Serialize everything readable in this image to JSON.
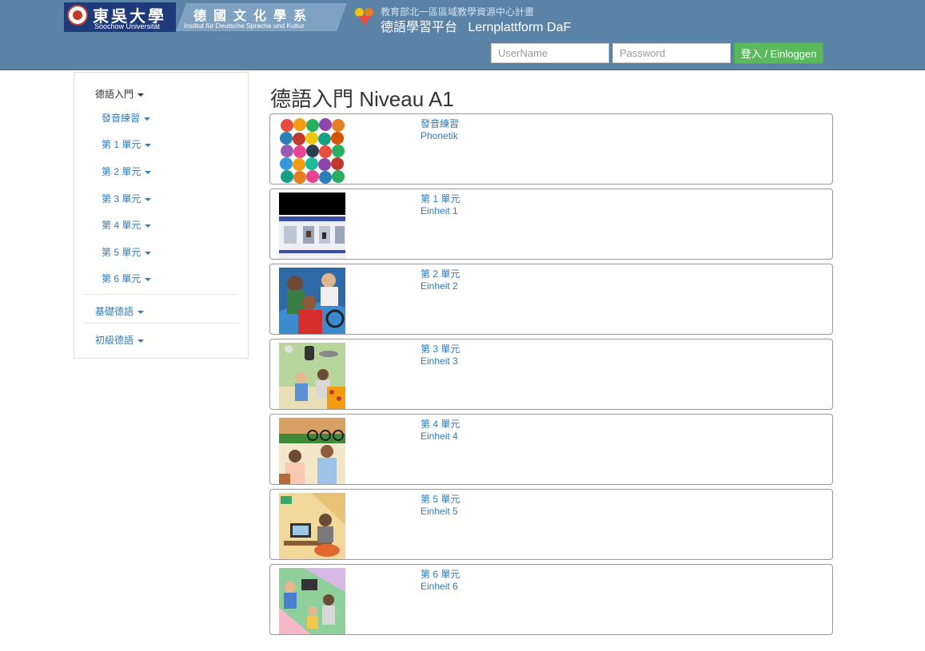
{
  "header": {
    "university_name_cn": "東吳大學",
    "university_name_en": "Soochow Universität",
    "dept_name_cn": "德國文化學系",
    "dept_name_de": "Institut für Deutsche Sprache und Kultur",
    "project_subtitle": "教育部北一區區域教學資源中心計畫",
    "platform_title": "德語學習平台   Lernplattform DaF",
    "username_placeholder": "UserName",
    "password_placeholder": "Password",
    "login_label": "登入 / Einloggen",
    "colors": {
      "bar": "#5b83a6",
      "login_button": "#5cb85c"
    }
  },
  "sidebar": {
    "top_label": "德語入門",
    "units": [
      "發音練習",
      "第 1 單元",
      "第 2 單元",
      "第 3 單元",
      "第 4 單元",
      "第 5 單元",
      "第 6 單元"
    ],
    "groups": [
      "基礎德語",
      "初級德語"
    ]
  },
  "main": {
    "title": "德語入門 Niveau A1",
    "cards": [
      {
        "label_cn": "發音練習",
        "label_de": "Phonetik",
        "thumb": "alphabet-illustration"
      },
      {
        "label_cn": "第 1 單元",
        "label_de": "Einheit 1",
        "thumb": "train-illustration"
      },
      {
        "label_cn": "第 2 單元",
        "label_de": "Einheit 2",
        "thumb": "cyclists-illustration"
      },
      {
        "label_cn": "第 3 單元",
        "label_de": "Einheit 3",
        "thumb": "shopping-illustration"
      },
      {
        "label_cn": "第 4 單元",
        "label_de": "Einheit 4",
        "thumb": "street-phone-illustration"
      },
      {
        "label_cn": "第 5 單元",
        "label_de": "Einheit 5",
        "thumb": "computer-room-illustration"
      },
      {
        "label_cn": "第 6 單元",
        "label_de": "Einheit 6",
        "thumb": "family-room-illustration"
      }
    ]
  }
}
